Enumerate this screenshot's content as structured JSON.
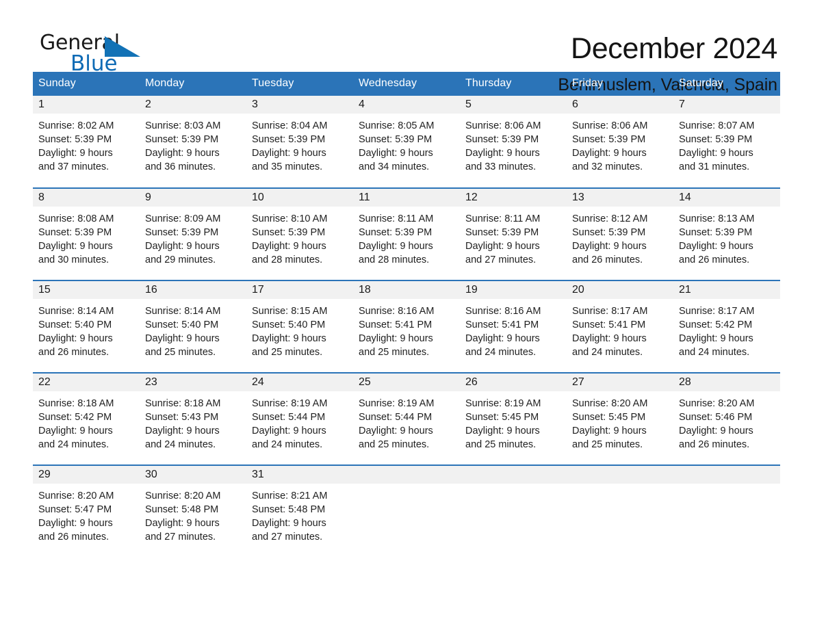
{
  "brand": {
    "name_part1": "General",
    "name_part2": "Blue",
    "triangle_color": "#1272b6",
    "part1_color": "#1a1a1a",
    "part2_color": "#0f6bb5"
  },
  "header": {
    "title": "December 2024",
    "subtitle": "Benimuslem, Valencia, Spain"
  },
  "theme": {
    "header_blue": "#2b74b8",
    "day_band_gray": "#f1f1f1",
    "text_color": "#1a1a1a"
  },
  "calendar": {
    "weekdays": [
      "Sunday",
      "Monday",
      "Tuesday",
      "Wednesday",
      "Thursday",
      "Friday",
      "Saturday"
    ],
    "weeks": [
      [
        {
          "day": "1",
          "detail": "Sunrise: 8:02 AM\nSunset: 5:39 PM\nDaylight: 9 hours\nand 37 minutes."
        },
        {
          "day": "2",
          "detail": "Sunrise: 8:03 AM\nSunset: 5:39 PM\nDaylight: 9 hours\nand 36 minutes."
        },
        {
          "day": "3",
          "detail": "Sunrise: 8:04 AM\nSunset: 5:39 PM\nDaylight: 9 hours\nand 35 minutes."
        },
        {
          "day": "4",
          "detail": "Sunrise: 8:05 AM\nSunset: 5:39 PM\nDaylight: 9 hours\nand 34 minutes."
        },
        {
          "day": "5",
          "detail": "Sunrise: 8:06 AM\nSunset: 5:39 PM\nDaylight: 9 hours\nand 33 minutes."
        },
        {
          "day": "6",
          "detail": "Sunrise: 8:06 AM\nSunset: 5:39 PM\nDaylight: 9 hours\nand 32 minutes."
        },
        {
          "day": "7",
          "detail": "Sunrise: 8:07 AM\nSunset: 5:39 PM\nDaylight: 9 hours\nand 31 minutes."
        }
      ],
      [
        {
          "day": "8",
          "detail": "Sunrise: 8:08 AM\nSunset: 5:39 PM\nDaylight: 9 hours\nand 30 minutes."
        },
        {
          "day": "9",
          "detail": "Sunrise: 8:09 AM\nSunset: 5:39 PM\nDaylight: 9 hours\nand 29 minutes."
        },
        {
          "day": "10",
          "detail": "Sunrise: 8:10 AM\nSunset: 5:39 PM\nDaylight: 9 hours\nand 28 minutes."
        },
        {
          "day": "11",
          "detail": "Sunrise: 8:11 AM\nSunset: 5:39 PM\nDaylight: 9 hours\nand 28 minutes."
        },
        {
          "day": "12",
          "detail": "Sunrise: 8:11 AM\nSunset: 5:39 PM\nDaylight: 9 hours\nand 27 minutes."
        },
        {
          "day": "13",
          "detail": "Sunrise: 8:12 AM\nSunset: 5:39 PM\nDaylight: 9 hours\nand 26 minutes."
        },
        {
          "day": "14",
          "detail": "Sunrise: 8:13 AM\nSunset: 5:39 PM\nDaylight: 9 hours\nand 26 minutes."
        }
      ],
      [
        {
          "day": "15",
          "detail": "Sunrise: 8:14 AM\nSunset: 5:40 PM\nDaylight: 9 hours\nand 26 minutes."
        },
        {
          "day": "16",
          "detail": "Sunrise: 8:14 AM\nSunset: 5:40 PM\nDaylight: 9 hours\nand 25 minutes."
        },
        {
          "day": "17",
          "detail": "Sunrise: 8:15 AM\nSunset: 5:40 PM\nDaylight: 9 hours\nand 25 minutes."
        },
        {
          "day": "18",
          "detail": "Sunrise: 8:16 AM\nSunset: 5:41 PM\nDaylight: 9 hours\nand 25 minutes."
        },
        {
          "day": "19",
          "detail": "Sunrise: 8:16 AM\nSunset: 5:41 PM\nDaylight: 9 hours\nand 24 minutes."
        },
        {
          "day": "20",
          "detail": "Sunrise: 8:17 AM\nSunset: 5:41 PM\nDaylight: 9 hours\nand 24 minutes."
        },
        {
          "day": "21",
          "detail": "Sunrise: 8:17 AM\nSunset: 5:42 PM\nDaylight: 9 hours\nand 24 minutes."
        }
      ],
      [
        {
          "day": "22",
          "detail": "Sunrise: 8:18 AM\nSunset: 5:42 PM\nDaylight: 9 hours\nand 24 minutes."
        },
        {
          "day": "23",
          "detail": "Sunrise: 8:18 AM\nSunset: 5:43 PM\nDaylight: 9 hours\nand 24 minutes."
        },
        {
          "day": "24",
          "detail": "Sunrise: 8:19 AM\nSunset: 5:44 PM\nDaylight: 9 hours\nand 24 minutes."
        },
        {
          "day": "25",
          "detail": "Sunrise: 8:19 AM\nSunset: 5:44 PM\nDaylight: 9 hours\nand 25 minutes."
        },
        {
          "day": "26",
          "detail": "Sunrise: 8:19 AM\nSunset: 5:45 PM\nDaylight: 9 hours\nand 25 minutes."
        },
        {
          "day": "27",
          "detail": "Sunrise: 8:20 AM\nSunset: 5:45 PM\nDaylight: 9 hours\nand 25 minutes."
        },
        {
          "day": "28",
          "detail": "Sunrise: 8:20 AM\nSunset: 5:46 PM\nDaylight: 9 hours\nand 26 minutes."
        }
      ],
      [
        {
          "day": "29",
          "detail": "Sunrise: 8:20 AM\nSunset: 5:47 PM\nDaylight: 9 hours\nand 26 minutes."
        },
        {
          "day": "30",
          "detail": "Sunrise: 8:20 AM\nSunset: 5:48 PM\nDaylight: 9 hours\nand 27 minutes."
        },
        {
          "day": "31",
          "detail": "Sunrise: 8:21 AM\nSunset: 5:48 PM\nDaylight: 9 hours\nand 27 minutes."
        },
        {
          "day": "",
          "detail": ""
        },
        {
          "day": "",
          "detail": ""
        },
        {
          "day": "",
          "detail": ""
        },
        {
          "day": "",
          "detail": ""
        }
      ]
    ]
  }
}
